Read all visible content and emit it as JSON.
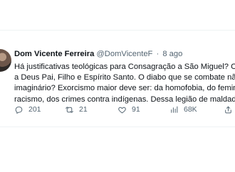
{
  "tweet": {
    "author_name": "Dom Vicente Ferreira",
    "author_handle": "@DomVicenteF",
    "dot": "·",
    "time": "8 ago",
    "lines": [
      "Há justificativas teológicas para Consagração a São Miguel? Consagra-s",
      "a Deus Pai, Filho e Espírito Santo. O diabo que se combate não é muito",
      "imaginário? Exorcismo maior deve ser: da homofobia, do feminicídio, do",
      "racismo, dos crimes contra indígenas. Dessa legião de maldades."
    ]
  },
  "actions": {
    "reply_count": "201",
    "retweet_count": "21",
    "like_count": "91",
    "view_count": "68K",
    "icons": {
      "reply": "reply-icon",
      "retweet": "retweet-icon",
      "like": "like-icon",
      "views": "views-icon",
      "share": "share-icon"
    }
  }
}
